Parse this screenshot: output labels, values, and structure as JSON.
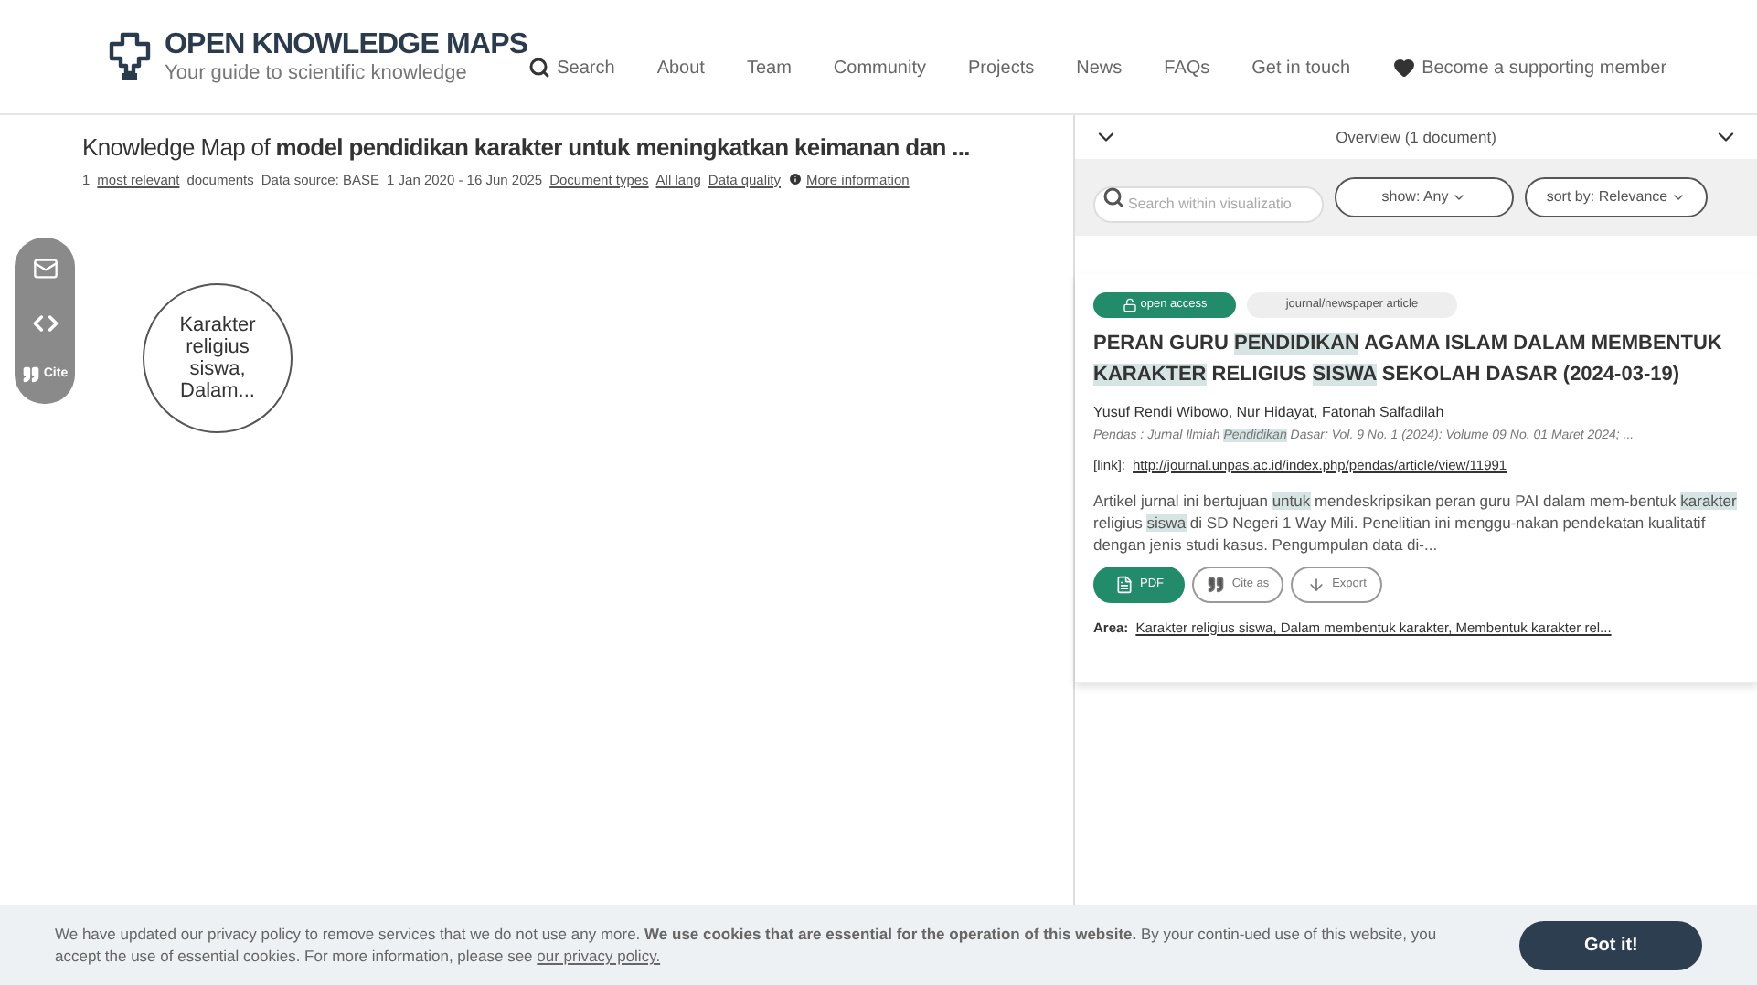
{
  "logo": {
    "title": "OPEN KNOWLEDGE MAPS",
    "tagline": "Your guide to scientific knowledge"
  },
  "nav": [
    {
      "label": "Search",
      "kind": "search"
    },
    {
      "label": "About",
      "kind": "link"
    },
    {
      "label": "Team",
      "kind": "link"
    },
    {
      "label": "Community",
      "kind": "link"
    },
    {
      "label": "Projects",
      "kind": "link"
    },
    {
      "label": "News",
      "kind": "link"
    },
    {
      "label": "FAQs",
      "kind": "link"
    },
    {
      "label": "Get in touch",
      "kind": "link"
    },
    {
      "label": "Become a supporting member",
      "kind": "heart"
    }
  ],
  "map_title": "Knowledge Map of **model pendidikan karakter untuk meningkatkan keimanan dan ...**",
  "meta": [
    {
      "text": "1",
      "link": false
    },
    {
      "text": "most relevant",
      "link": true
    },
    {
      "text": "documents",
      "link": false
    },
    {
      "text": "Data source: BASE",
      "link": false
    },
    {
      "text": "1 Jan 2020 - 16 Jun 2025",
      "link": false
    },
    {
      "text": "Document types",
      "link": true
    },
    {
      "text": "All lang",
      "link": true
    },
    {
      "text": "Data quality",
      "link": true
    },
    {
      "text": "More information",
      "link": true
    }
  ],
  "side_tools": [
    {
      "kind": "email"
    },
    {
      "kind": "embed"
    },
    {
      "kind": "cite",
      "label": "Cite"
    }
  ],
  "bubble": "Karakter religius siswa, Dalam...",
  "panel": {
    "header": "Overview (1 document)",
    "search_placeholder": "Search within visualizatio",
    "show": "show: Any",
    "sort": "sort by: Relevance"
  },
  "doc": {
    "badges": [
      {
        "label": "open access",
        "kind": "access"
      },
      {
        "label": "journal/newspaper article",
        "kind": "type"
      }
    ],
    "title": [
      {
        "t": "PERAN GURU ",
        "hl": false
      },
      {
        "t": "PENDIDIKAN",
        "hl": true
      },
      {
        "t": " AGAMA ISLAM DALAM MEMBENTUK ",
        "hl": false
      },
      {
        "t": "KARAKTER",
        "hl": true
      },
      {
        "t": " RELIGIUS ",
        "hl": false
      },
      {
        "t": "SISWA",
        "hl": true
      },
      {
        "t": " SEKOLAH DASAR (2024-03-19)",
        "hl": false
      }
    ],
    "authors": "Yusuf Rendi Wibowo, Nur Hidayat, Fatonah Salfadilah",
    "journal": [
      {
        "t": "Pendas : Jurnal Ilmiah ",
        "hl": false
      },
      {
        "t": "Pendidikan",
        "hl": true
      },
      {
        "t": " Dasar; Vol. 9 No. 1 (2024): Volume 09 No. 01 Maret 2024; ...",
        "hl": false
      }
    ],
    "link_label": "[link]:",
    "link": "http://journal.unpas.ac.id/index.php/pendas/article/view/11991",
    "abstract": [
      {
        "t": "Artikel jurnal ini bertujuan ",
        "hl": false
      },
      {
        "t": "untuk",
        "hl": true
      },
      {
        "t": " mendeskripsikan peran guru PAI dalam mem-bentuk ",
        "hl": false
      },
      {
        "t": "karakter",
        "hl": true
      },
      {
        "t": " religius ",
        "hl": false
      },
      {
        "t": "siswa",
        "hl": true
      },
      {
        "t": " di SD Negeri 1 Way Mili. Penelitian ini menggu-nakan pendekatan kualitatif dengan jenis studi kasus. Pengumpulan data di-...",
        "hl": false
      }
    ],
    "actions": [
      {
        "label": "PDF",
        "kind": "pdf"
      },
      {
        "label": "Cite as",
        "kind": "cite"
      },
      {
        "label": "Export",
        "kind": "export"
      }
    ],
    "area_label": "Area:",
    "area": "Karakter religius siswa, Dalam membentuk karakter, Membentuk karakter rel..."
  },
  "cookie": {
    "text": "We have updated our privacy policy to remove services that we do not use any more. **We use cookies that are essential for the operation of this website.** By your contin-ued use of this website, you accept the use of essential cookies. For more information, please see",
    "link": "our privacy policy.",
    "button": "Got it!"
  }
}
